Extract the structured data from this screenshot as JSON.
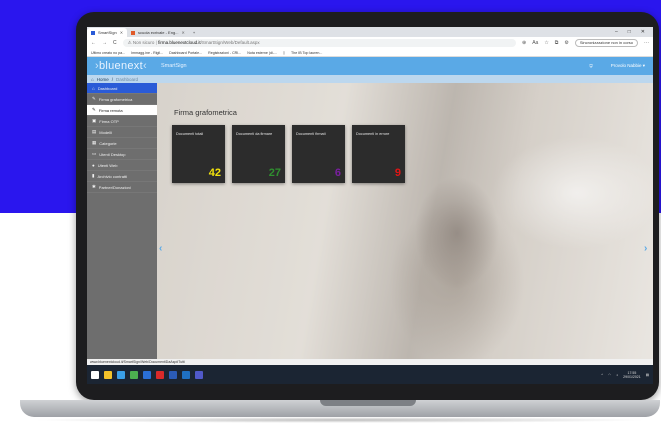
{
  "browser": {
    "tabs": [
      {
        "label": "SmartSign",
        "active": true
      },
      {
        "label": "scuola ecrivale - Eng...",
        "active": false
      }
    ],
    "new_tab": "+",
    "window_controls": [
      "–",
      "□",
      "✕"
    ],
    "nav": {
      "back": "←",
      "forward": "→",
      "reload": "C"
    },
    "security": "Non sicuro",
    "url_host": "firma.bluenextcloud.it",
    "url_path": "/SmartSign/Web/Default.aspx",
    "sync_label": "Sincronizzazione non in corso",
    "bookmarks": [
      "Ultimo creato no pa...",
      "Immagg.ine - Rigil...",
      "Dashboard Portale...",
      "Registrazioni - CRI...",
      "Nota esterne (di-...",
      "",
      "The IB Top lauren..."
    ]
  },
  "app": {
    "logo": "bluenext",
    "name": "SmartSign",
    "user": "Provolo Nabbie",
    "breadcrumb": {
      "home": "Home",
      "separator": "/",
      "current": "Dashboard"
    }
  },
  "sidebar": {
    "items": [
      {
        "label": "Dashboard",
        "icon": "⌂",
        "state": "active"
      },
      {
        "label": "Firma grafometrica",
        "icon": "✎",
        "state": "normal"
      },
      {
        "label": "Firma remota",
        "icon": "✎",
        "state": "selected"
      },
      {
        "label": "Firma OTP",
        "icon": "▣",
        "state": "normal"
      },
      {
        "label": "Modelli",
        "icon": "▤",
        "state": "normal"
      },
      {
        "label": "Categorie",
        "icon": "▦",
        "state": "normal"
      },
      {
        "label": "Utenti Desktop",
        "icon": "▭",
        "state": "normal"
      },
      {
        "label": "Utenti Web",
        "icon": "●",
        "state": "normal"
      },
      {
        "label": "Archivio contratti",
        "icon": "▮",
        "state": "normal"
      },
      {
        "label": "Partner/Donazioni",
        "icon": "✱",
        "state": "normal"
      }
    ]
  },
  "main": {
    "section_title": "Firma grafometrica",
    "cards": [
      {
        "title": "Documenti totali",
        "value": "42",
        "color": "#f2e20c"
      },
      {
        "title": "Documenti da firmare",
        "value": "27",
        "color": "#2f8f2f"
      },
      {
        "title": "Documenti firmati",
        "value": "6",
        "color": "#7a1fa0"
      },
      {
        "title": "Documenti in errore",
        "value": "9",
        "color": "#e01515"
      }
    ],
    "prev_arrow": "‹",
    "next_arrow": "›",
    "carousel_dots": "●●●"
  },
  "statusbar": {
    "text": "www.bluenextcloud.it/SmartSign/Web/DocumentiDaAsp#Tutti"
  },
  "taskbar": {
    "icons": [
      {
        "name": "start",
        "color": "#ffffff"
      },
      {
        "name": "explorer",
        "color": "#f3c22a"
      },
      {
        "name": "edge",
        "color": "#3aa0e8"
      },
      {
        "name": "chrome",
        "color": "#4caf50"
      },
      {
        "name": "app-blue",
        "color": "#2a6fd6"
      },
      {
        "name": "acrobat",
        "color": "#d92a2a"
      },
      {
        "name": "word",
        "color": "#2b5cb8"
      },
      {
        "name": "outlook",
        "color": "#1f70c1"
      },
      {
        "name": "teams",
        "color": "#5059c9"
      }
    ],
    "time": "17:55",
    "date": "29/01/2021"
  },
  "colors": {
    "background_top": "#2a16ee",
    "header": "#5aa9e6",
    "sidebar": "#6e6e6e",
    "sidebar_active": "#2a5bd7",
    "card_bg": "#2c2c2c"
  }
}
